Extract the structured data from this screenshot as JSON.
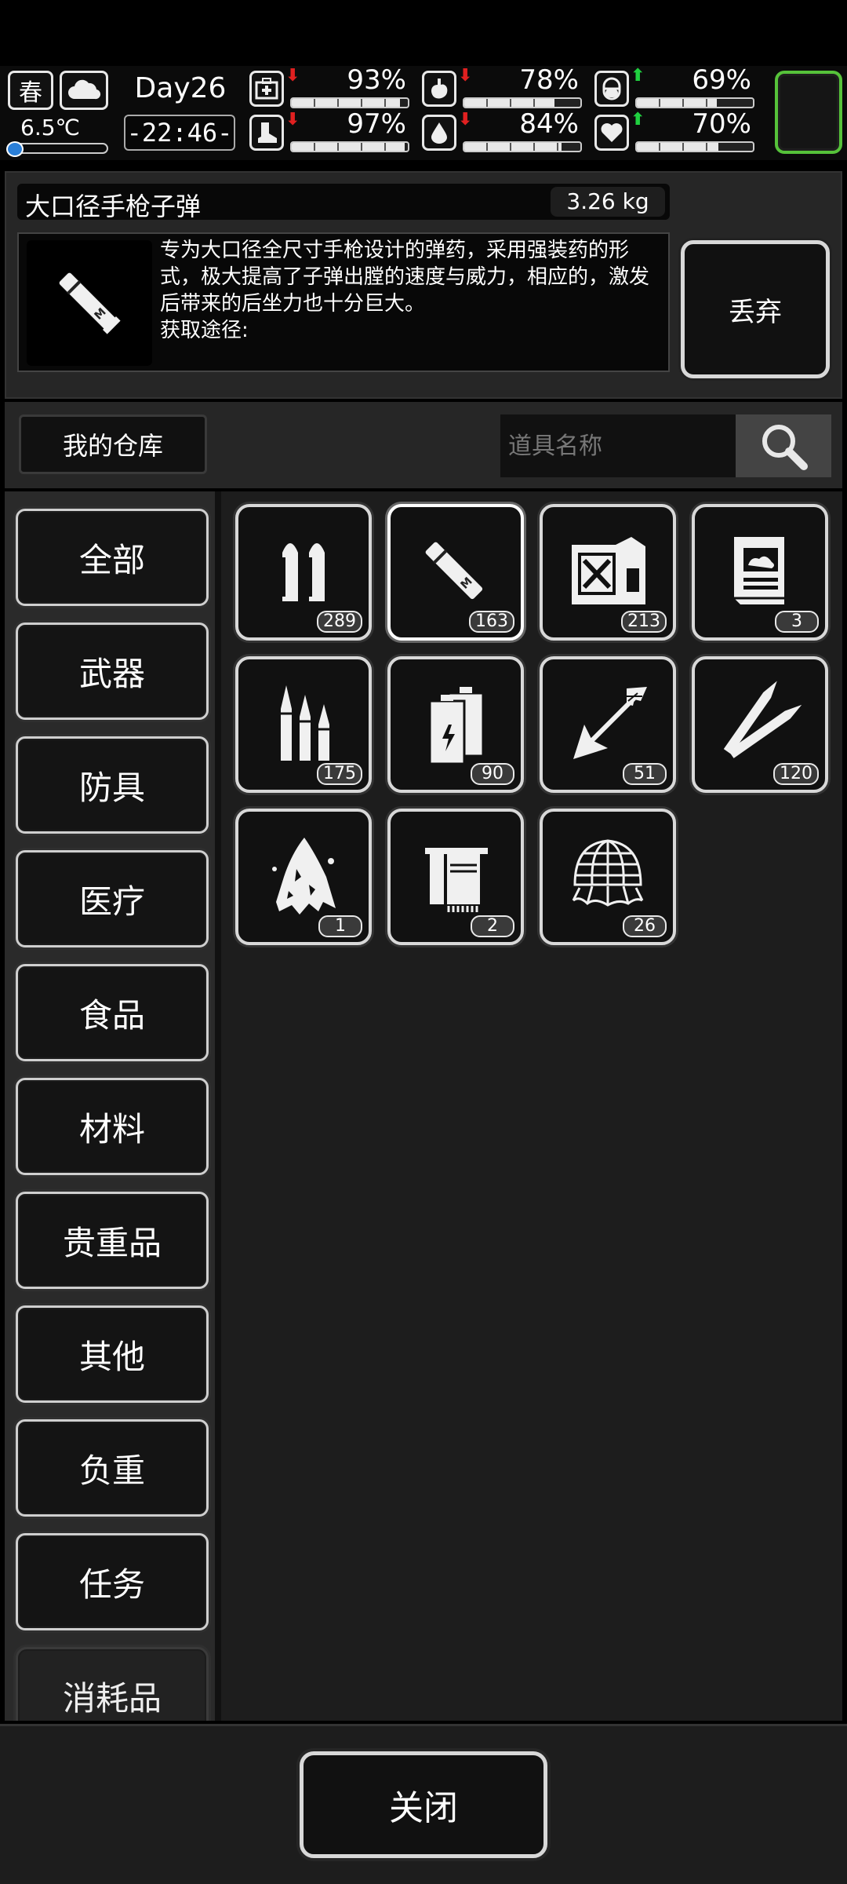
{
  "hud": {
    "season": "春",
    "weather_icon": "cloud-icon",
    "temperature": "6.5℃",
    "day": "Day26",
    "clock": "-22:46-",
    "stats": [
      {
        "name": "health",
        "icon": "medkit-icon",
        "value": "93%",
        "trend": "down",
        "level": 0.93
      },
      {
        "name": "hunger",
        "icon": "stomach-icon",
        "value": "78%",
        "trend": "down",
        "level": 0.78
      },
      {
        "name": "medicine",
        "icon": "pill-icon",
        "value": "69%",
        "trend": "up",
        "level": 0.69
      },
      {
        "name": "stamina",
        "icon": "boot-icon",
        "value": "97%",
        "trend": "down",
        "level": 0.97
      },
      {
        "name": "thirst",
        "icon": "water-drop-icon",
        "value": "84%",
        "trend": "down",
        "level": 0.84
      },
      {
        "name": "mood",
        "icon": "heart-icon",
        "value": "70%",
        "trend": "up",
        "level": 0.7
      }
    ],
    "accent_color": "#56c23a"
  },
  "detail": {
    "name": "大口径手枪子弹",
    "weight": "3.26 kg",
    "description": "专为大口径全尺寸手枪设计的弹药，采用强装药的形式，极大提高了子弹出膛的速度与威力，相应的，激发后带来的后坐力也十分巨大。",
    "source_label": "获取途径:",
    "drop_label": "丢弃"
  },
  "warehouse": {
    "label": "我的仓库",
    "search_placeholder": "道具名称"
  },
  "categories": [
    "全部",
    "武器",
    "防具",
    "医疗",
    "食品",
    "材料",
    "贵重品",
    "其他",
    "负重",
    "任务",
    "消耗品"
  ],
  "items": [
    {
      "icon": "pistol-bullets-icon",
      "count": "289"
    },
    {
      "icon": "large-caliber-bullet-icon",
      "count": "163",
      "selected": true
    },
    {
      "icon": "fuel-can-icon",
      "count": "213"
    },
    {
      "icon": "book-icon",
      "count": "3"
    },
    {
      "icon": "rifle-bullets-icon",
      "count": "175"
    },
    {
      "icon": "battery-icon",
      "count": "90"
    },
    {
      "icon": "arrow-icon",
      "count": "51"
    },
    {
      "icon": "sniper-bullets-icon",
      "count": "120"
    },
    {
      "icon": "torn-cloth-icon",
      "count": "1"
    },
    {
      "icon": "towel-icon",
      "count": "2"
    },
    {
      "icon": "net-icon",
      "count": "26"
    }
  ],
  "footer": {
    "close_label": "关闭"
  }
}
